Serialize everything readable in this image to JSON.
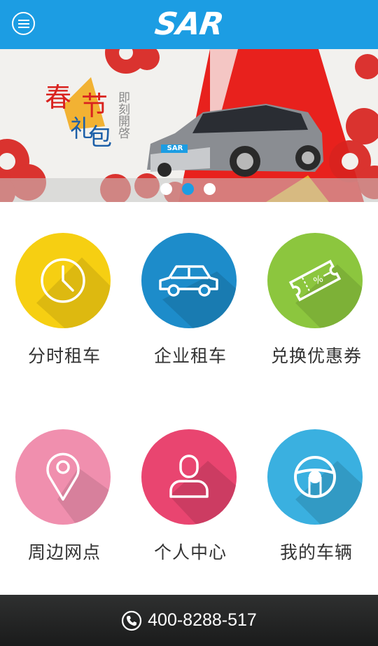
{
  "header": {
    "logo_text": "SAR",
    "menu_icon": "menu-icon"
  },
  "banner": {
    "headline": [
      "春",
      "节",
      "礼",
      "包"
    ],
    "subline": "即刻開啓",
    "car_plate": "SAR",
    "slides": 3,
    "active_slide": 2
  },
  "tiles": [
    {
      "label": "分时租车",
      "icon": "clock-icon",
      "color": "#f6cf12"
    },
    {
      "label": "企业租车",
      "icon": "car-icon",
      "color": "#1d8cca"
    },
    {
      "label": "兑换优惠券",
      "icon": "coupon-icon",
      "color": "#8cc63e"
    },
    {
      "label": "周边网点",
      "icon": "location-pin-icon",
      "color": "#f08fae"
    },
    {
      "label": "个人中心",
      "icon": "user-icon",
      "color": "#e94570"
    },
    {
      "label": "我的车辆",
      "icon": "steering-wheel-icon",
      "color": "#3ab0e0"
    }
  ],
  "footer": {
    "phone": "400-8288-517",
    "icon": "phone-icon"
  }
}
